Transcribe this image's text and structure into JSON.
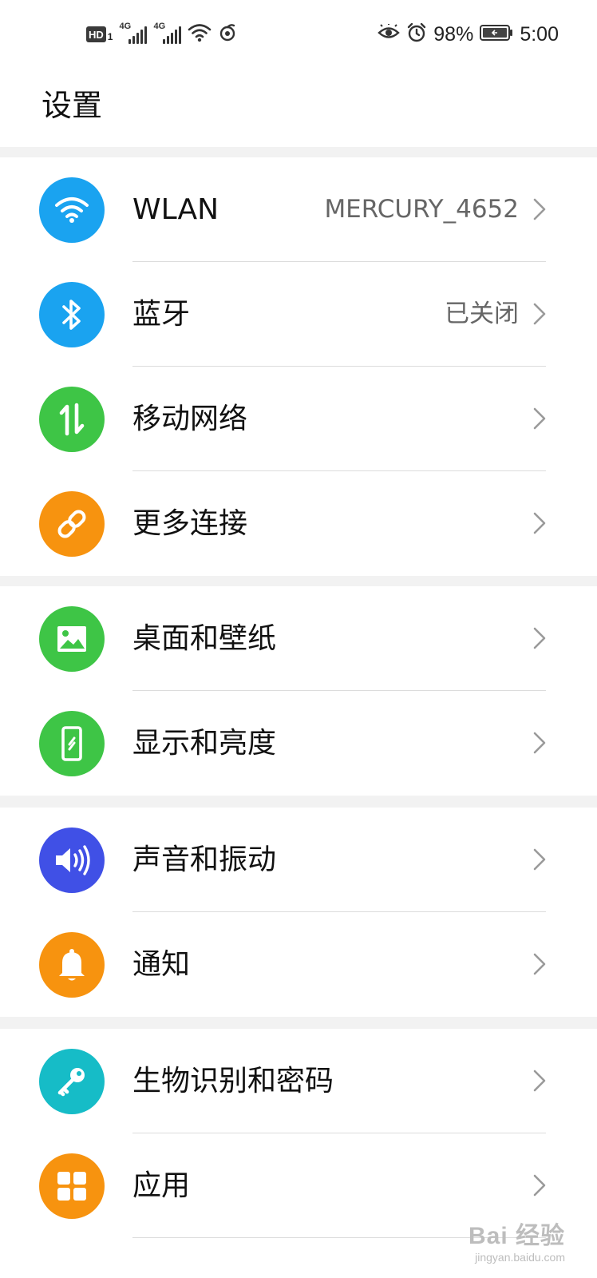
{
  "status_bar": {
    "hd_label": "HD",
    "hd_sub": "1",
    "sim1_tag": "4G",
    "sim2_tag": "4G",
    "battery_percent": "98%",
    "time": "5:00"
  },
  "page": {
    "title": "设置"
  },
  "groups": [
    {
      "rows": [
        {
          "label": "WLAN",
          "value": "MERCURY_4652",
          "icon": "wifi-icon",
          "color": "#1aa3f0"
        },
        {
          "label": "蓝牙",
          "value": "已关闭",
          "icon": "bluetooth-icon",
          "color": "#1aa3f0"
        },
        {
          "label": "移动网络",
          "value": "",
          "icon": "mobile-data-icon",
          "color": "#3ec546"
        },
        {
          "label": "更多连接",
          "value": "",
          "icon": "link-icon",
          "color": "#f7930f"
        }
      ]
    },
    {
      "rows": [
        {
          "label": "桌面和壁纸",
          "value": "",
          "icon": "wallpaper-icon",
          "color": "#3ec546"
        },
        {
          "label": "显示和亮度",
          "value": "",
          "icon": "display-icon",
          "color": "#3ec546"
        }
      ]
    },
    {
      "rows": [
        {
          "label": "声音和振动",
          "value": "",
          "icon": "sound-icon",
          "color": "#4050e6"
        },
        {
          "label": "通知",
          "value": "",
          "icon": "bell-icon",
          "color": "#f7930f"
        }
      ]
    },
    {
      "rows": [
        {
          "label": "生物识别和密码",
          "value": "",
          "icon": "key-icon",
          "color": "#16bcc7"
        },
        {
          "label": "应用",
          "value": "",
          "icon": "apps-icon",
          "color": "#f7930f"
        }
      ]
    }
  ],
  "watermark": {
    "main": "Bai 经验",
    "sub": "jingyan.baidu.com"
  }
}
